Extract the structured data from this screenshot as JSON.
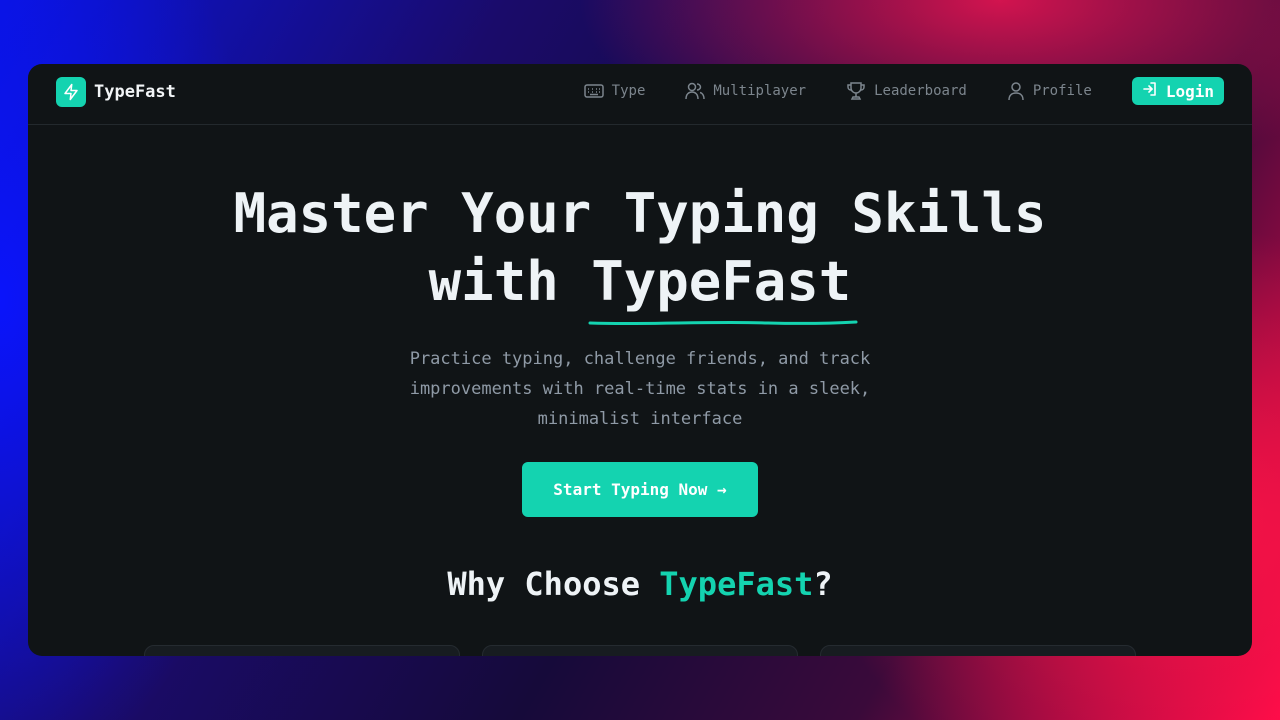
{
  "brand": {
    "name": "TypeFast",
    "icon": "lightning-bolt-icon",
    "accent_color": "#14d3b0"
  },
  "nav": {
    "items": [
      {
        "label": "Type",
        "icon": "keyboard-icon"
      },
      {
        "label": "Multiplayer",
        "icon": "users-icon"
      },
      {
        "label": "Leaderboard",
        "icon": "trophy-icon"
      },
      {
        "label": "Profile",
        "icon": "user-icon"
      }
    ],
    "login_label": "Login",
    "login_icon": "login-arrow-icon"
  },
  "hero": {
    "title_line1": "Master Your Typing Skills",
    "title_line2_prefix": "with ",
    "title_line2_highlight": "TypeFast",
    "subtitle": "Practice typing, challenge friends, and track improvements with real-time stats in a sleek, minimalist interface",
    "cta_label": "Start Typing Now →"
  },
  "features": {
    "title_prefix": "Why Choose ",
    "title_highlight": "TypeFast",
    "title_suffix": "?",
    "card_count_visible": 3
  },
  "colors": {
    "background": "#101416",
    "accent": "#14d3b0",
    "muted_text": "#8f9aa6"
  }
}
